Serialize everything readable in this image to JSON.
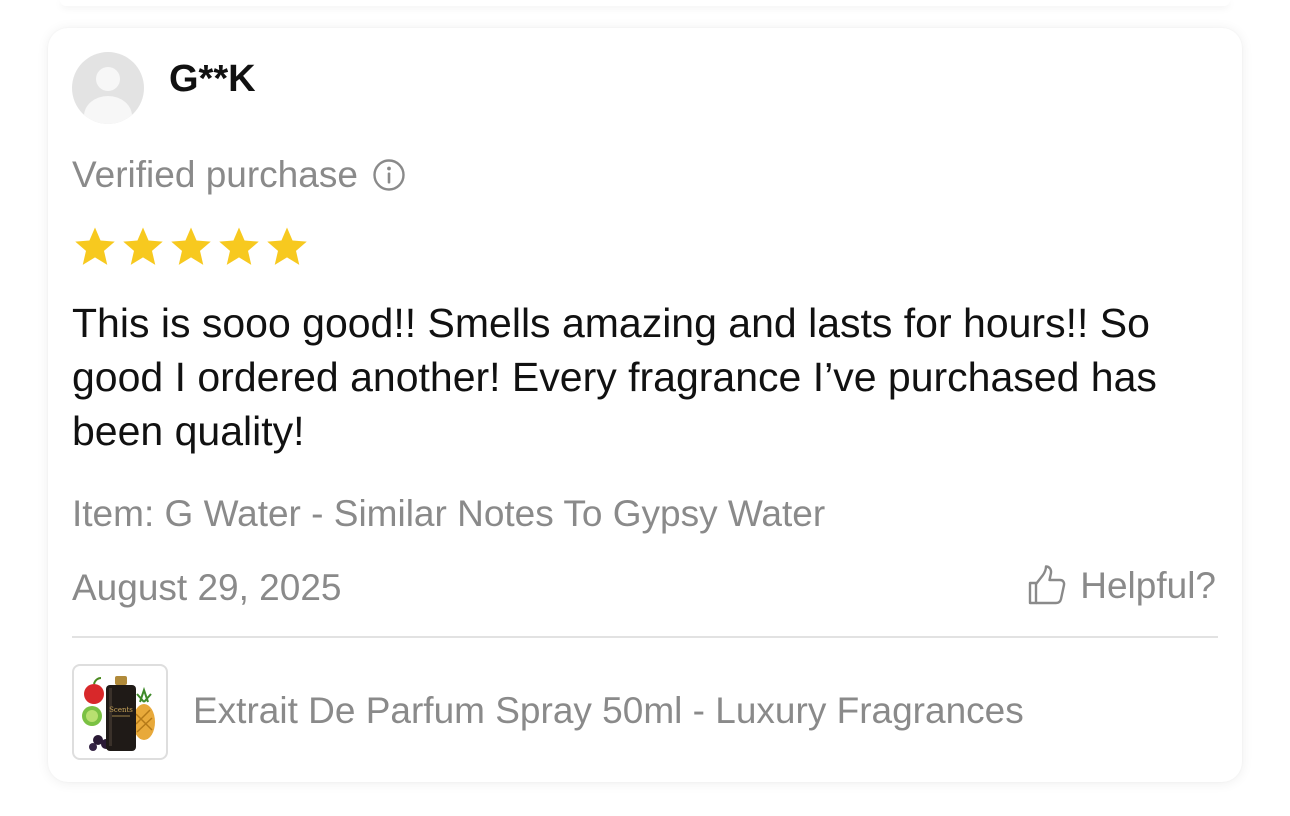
{
  "review": {
    "reviewer_name": "G**K",
    "verified_label": "Verified purchase",
    "rating": 5,
    "rating_max": 5,
    "star_color": "#f7c91f",
    "text": "This is sooo good!! Smells amazing and lasts for hours!! So good I ordered another! Every fragrance I’ve purchased has been quality!",
    "item_label": "Item: G Water - Similar Notes To Gypsy Water",
    "date": "August 29, 2025",
    "helpful_label": "Helpful?"
  },
  "product": {
    "name": "Extrait De Parfum Spray 50ml - Luxury Fragrances",
    "bottle_label": "Scents"
  },
  "icons": {
    "avatar": "user-avatar-icon",
    "info": "info-circle-icon",
    "star": "star-icon",
    "helpful": "thumbs-up-icon"
  }
}
